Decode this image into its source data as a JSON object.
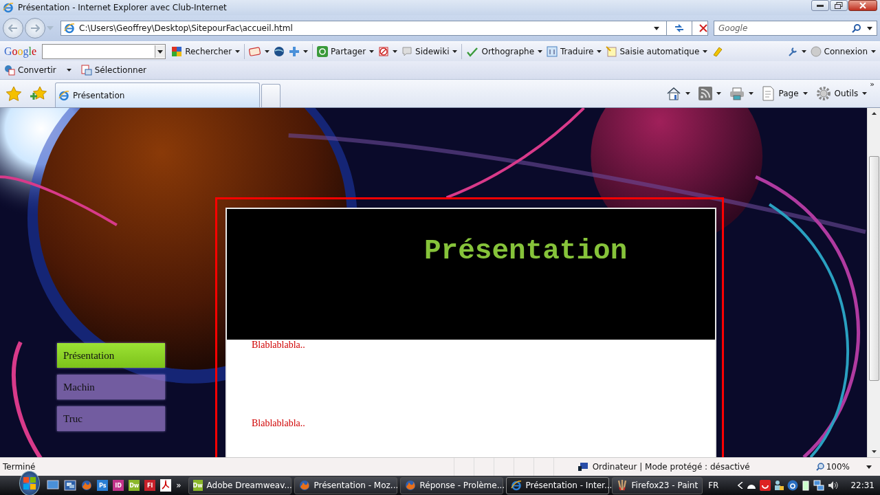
{
  "window": {
    "title": "Présentation - Internet Explorer avec Club-Internet"
  },
  "address_bar": {
    "url": "C:\\Users\\Geoffrey\\Desktop\\SitepourFac\\accueil.html"
  },
  "search": {
    "placeholder": "Google"
  },
  "google_toolbar": {
    "logo": "Google",
    "items": [
      {
        "kind": "button",
        "label": "Rechercher",
        "dropdown": true
      },
      {
        "kind": "icon",
        "dropdown": true
      },
      {
        "kind": "icon",
        "dropdown": false
      },
      {
        "kind": "icon",
        "dropdown": true
      },
      {
        "kind": "button",
        "label": "Partager",
        "dropdown": true
      },
      {
        "kind": "icon",
        "dropdown": true
      },
      {
        "kind": "button",
        "label": "Sidewiki",
        "dropdown": true
      },
      {
        "kind": "button",
        "label": "Orthographe",
        "dropdown": true
      },
      {
        "kind": "button",
        "label": "Traduire",
        "dropdown": true
      },
      {
        "kind": "button",
        "label": "Saisie automatique",
        "dropdown": true
      },
      {
        "kind": "icon",
        "dropdown": false
      }
    ],
    "right": [
      {
        "kind": "icon",
        "dropdown": true
      },
      {
        "kind": "button",
        "label": "Connexion",
        "dropdown": true
      }
    ]
  },
  "convert_bar": [
    {
      "label": "Convertir",
      "dropdown": true
    },
    {
      "label": "Sélectionner",
      "dropdown": false
    }
  ],
  "tabs": [
    {
      "label": "Présentation",
      "selected": true
    }
  ],
  "command_bar": {
    "items": [
      {
        "dropdown": true
      },
      {
        "dropdown": true
      },
      {
        "dropdown": true
      },
      {
        "label": "Page",
        "dropdown": true
      },
      {
        "label": "Outils",
        "dropdown": true
      }
    ],
    "overflow": "»"
  },
  "page": {
    "menu": [
      {
        "label": "Présentation",
        "selected": true
      },
      {
        "label": "Machin",
        "selected": false
      },
      {
        "label": "Truc",
        "selected": false
      }
    ],
    "heading": "Présentation",
    "paragraphs": [
      "Blablablabla..",
      "Blablablabla.."
    ]
  },
  "status_bar": {
    "status": "Terminé",
    "zone": "Ordinateur | Mode protégé : désactivé",
    "zoom": "100%"
  },
  "taskbar": {
    "quick_launch": [
      {
        "kind": "icon"
      },
      {
        "kind": "icon"
      },
      {
        "kind": "icon"
      },
      {
        "kind": "tile",
        "text": "Ps"
      },
      {
        "kind": "tile",
        "text": "ID"
      },
      {
        "kind": "tile",
        "text": "Dw"
      },
      {
        "kind": "tile",
        "text": "Fl"
      },
      {
        "kind": "icon"
      }
    ],
    "overflow": "»",
    "tasks": [
      {
        "label": "Adobe Dreamweav...",
        "tile": "Dw",
        "selected": false
      },
      {
        "label": "Présentation - Moz...",
        "selected": false
      },
      {
        "label": "Réponse - Prolème...",
        "selected": false
      },
      {
        "label": "Présentation - Inter...",
        "selected": true
      },
      {
        "label": "Firefox23 - Paint",
        "selected": false
      }
    ],
    "language": "FR",
    "clock": "22:31"
  }
}
